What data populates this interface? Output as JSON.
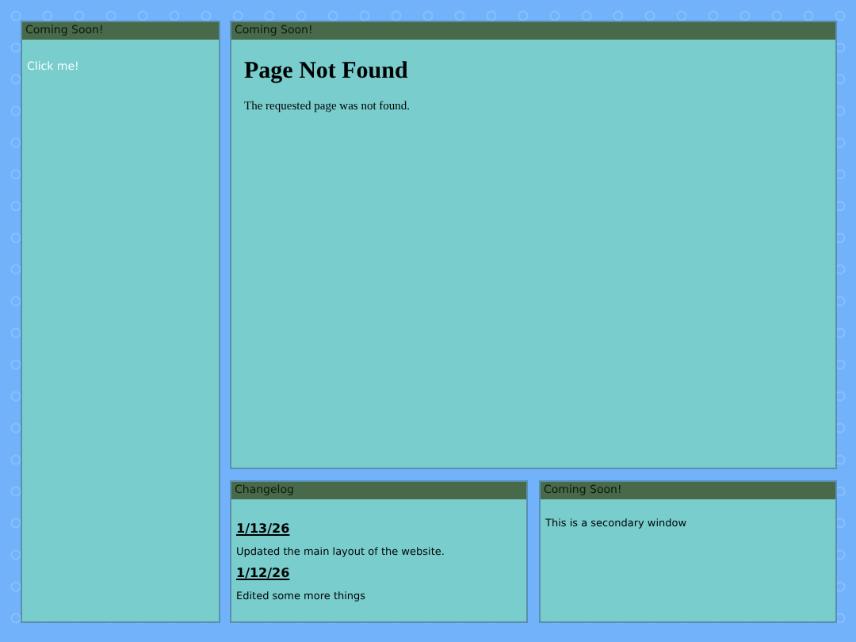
{
  "sidebar": {
    "title": "Coming Soon!",
    "link": "Click me!"
  },
  "main": {
    "title": "Coming Soon!",
    "heading": "Page Not Found",
    "message": "The requested page was not found."
  },
  "changelog": {
    "title": "Changelog",
    "entries": [
      {
        "date": "1/13/26",
        "text": "Updated the main layout of the website."
      },
      {
        "date": "1/12/26",
        "text": "Edited some more things"
      }
    ]
  },
  "secondary": {
    "title": "Coming Soon!",
    "text": "This is a secondary window"
  }
}
